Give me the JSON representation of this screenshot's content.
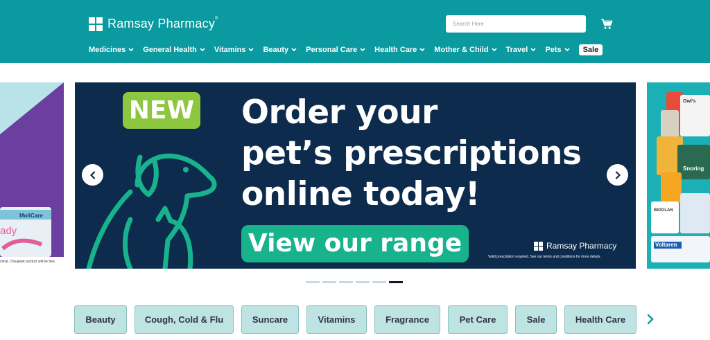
{
  "header": {
    "logo_text": "Ramsay Pharmacy",
    "logo_tm": "®",
    "search_placeholder": "Search Here",
    "cart_icon": "cart-icon"
  },
  "nav": {
    "items": [
      {
        "label": "Medicines"
      },
      {
        "label": "General Health"
      },
      {
        "label": "Vitamins"
      },
      {
        "label": "Beauty"
      },
      {
        "label": "Personal Care"
      },
      {
        "label": "Health Care"
      },
      {
        "label": "Mother & Child"
      },
      {
        "label": "Travel"
      },
      {
        "label": "Pets"
      }
    ],
    "sale_label": "Sale"
  },
  "banner": {
    "badge": "NEW",
    "headline_1": "Order your",
    "headline_2": "pet’s prescriptions",
    "headline_3": "online today!",
    "cta_label": "View our range",
    "brand": "Ramsay Pharmacy",
    "disclaimer": "Valid prescription required. See our terms and conditions for more details."
  },
  "side_slides": {
    "prev_brand": "MoliCare",
    "prev_text": "ady",
    "prev_fineprint": "ctical. Cheapest product will be free.",
    "next_products": [
      "Voltaren",
      "Snoring",
      "BIOGLAN",
      "Owl's"
    ]
  },
  "carousel": {
    "slide_count": 6,
    "active_index": 5
  },
  "categories": {
    "chips": [
      {
        "label": "Beauty"
      },
      {
        "label": "Cough, Cold & Flu"
      },
      {
        "label": "Suncare"
      },
      {
        "label": "Vitamins"
      },
      {
        "label": "Fragrance"
      },
      {
        "label": "Pet Care"
      },
      {
        "label": "Sale"
      },
      {
        "label": "Health Care"
      }
    ]
  },
  "colors": {
    "header": "#0b9aa0",
    "banner_bg": "#0d2b4c",
    "badge": "#8dc63f",
    "cta": "#16b38d",
    "chip": "#bde3e3"
  }
}
